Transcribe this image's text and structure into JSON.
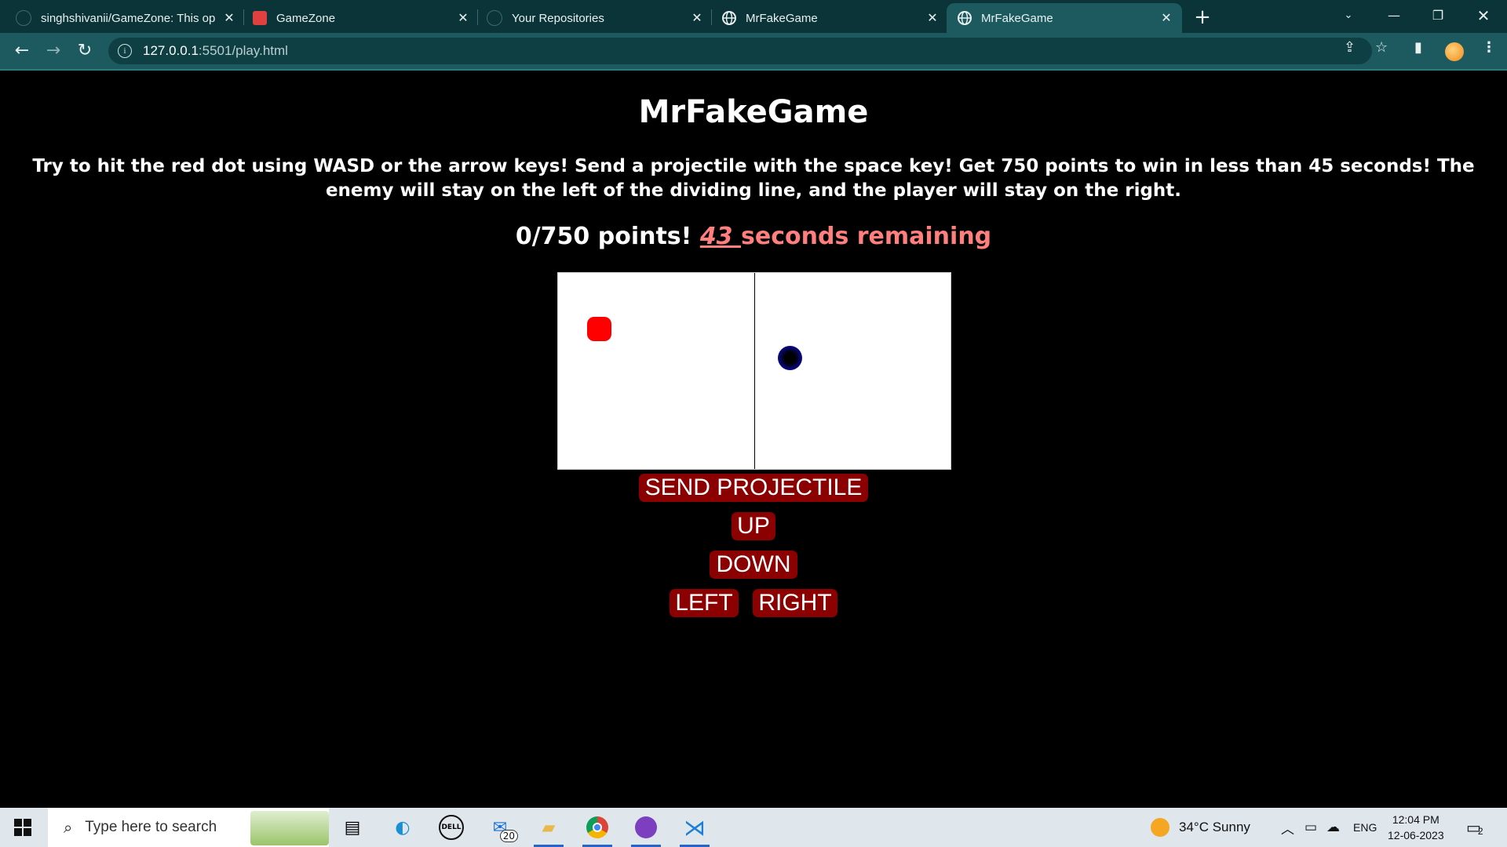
{
  "browser": {
    "tabs": [
      {
        "title": "singhshivanii/GameZone: This op",
        "icon": "github-icon"
      },
      {
        "title": "GameZone",
        "icon": "gamezone-icon"
      },
      {
        "title": "Your Repositories",
        "icon": "github-icon"
      },
      {
        "title": "MrFakeGame",
        "icon": "globe-icon"
      },
      {
        "title": "MrFakeGame",
        "icon": "globe-icon",
        "active": true
      }
    ],
    "new_tab": "+",
    "url_host": "127.0.0.1",
    "url_path": ":5501/play.html"
  },
  "page": {
    "title": "MrFakeGame",
    "instructions": "Try to hit the red dot using WASD or the arrow keys! Send a projectile with the space key! Get 750 points to win in less than 45 seconds! The enemy will stay on the left of the dividing line, and the player will stay on the right.",
    "score": "0/750 points!",
    "time_left": "43 ",
    "time_suffix": "seconds remaining",
    "buttons": {
      "send": "SEND PROJECTILE",
      "up": "UP",
      "down": "DOWN",
      "left": "LEFT",
      "right": "RIGHT"
    }
  },
  "taskbar": {
    "search_placeholder": "Type here to search",
    "mail_badge": "20",
    "weather": "34°C  Sunny",
    "language": "ENG",
    "time": "12:04 PM",
    "date": "12-06-2023",
    "notifications": "2"
  },
  "colors": {
    "button_bg": "#8b0000",
    "enemy": "#ff0000",
    "player": "#0000cc",
    "timer": "#ff7f7f"
  }
}
